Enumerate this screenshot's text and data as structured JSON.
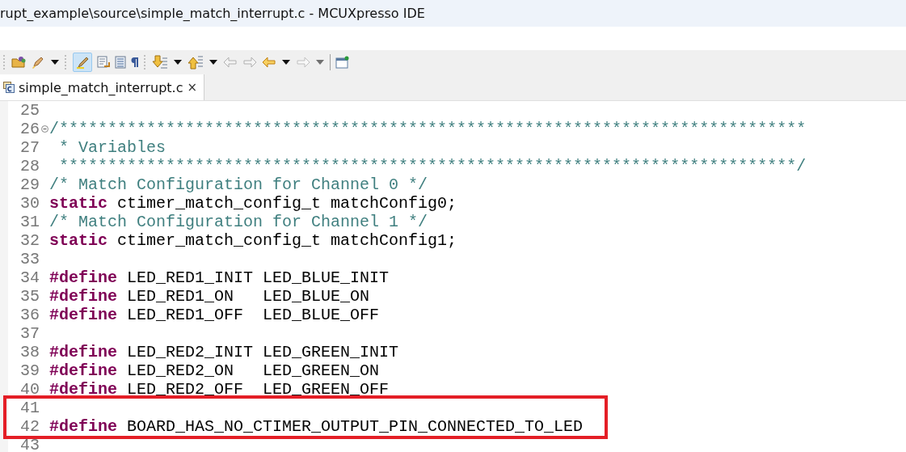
{
  "window": {
    "title": "rupt_example\\source\\simple_match_interrupt.c - MCUXpresso IDE"
  },
  "toolbar": {
    "toggle_on": true
  },
  "tabs": [
    {
      "label": "simple_match_interrupt.c",
      "close": "×",
      "selected": true
    }
  ],
  "editor": {
    "lines": [
      {
        "number": "25",
        "folded_marker": false,
        "highlighted": false
      },
      {
        "number": "26",
        "folded_marker": true,
        "highlighted": false,
        "tokens": [
          {
            "kind": "comment",
            "text": "/*****************************************************************************"
          }
        ]
      },
      {
        "number": "27",
        "folded_marker": false,
        "highlighted": false,
        "tokens": [
          {
            "kind": "comment",
            "text": " * Variables"
          }
        ]
      },
      {
        "number": "28",
        "folded_marker": false,
        "highlighted": false,
        "tokens": [
          {
            "kind": "comment",
            "text": " ****************************************************************************/"
          }
        ]
      },
      {
        "number": "29",
        "folded_marker": false,
        "highlighted": false,
        "tokens": [
          {
            "kind": "comment",
            "text": "/* Match Configuration for Channel 0 */"
          }
        ]
      },
      {
        "number": "30",
        "folded_marker": false,
        "highlighted": false,
        "tokens": [
          {
            "kind": "keyword",
            "text": "static"
          },
          {
            "kind": "plain",
            "text": " ctimer_match_config_t matchConfig0;"
          }
        ]
      },
      {
        "number": "31",
        "folded_marker": false,
        "highlighted": false,
        "tokens": [
          {
            "kind": "comment",
            "text": "/* Match Configuration for Channel 1 */"
          }
        ]
      },
      {
        "number": "32",
        "folded_marker": false,
        "highlighted": false,
        "tokens": [
          {
            "kind": "keyword",
            "text": "static"
          },
          {
            "kind": "plain",
            "text": " ctimer_match_config_t matchConfig1;"
          }
        ]
      },
      {
        "number": "33",
        "folded_marker": false,
        "highlighted": false
      },
      {
        "number": "34",
        "folded_marker": false,
        "highlighted": false,
        "tokens": [
          {
            "kind": "keyword",
            "text": "#define"
          },
          {
            "kind": "plain",
            "text": " LED_RED1_INIT LED_BLUE_INIT"
          }
        ]
      },
      {
        "number": "35",
        "folded_marker": false,
        "highlighted": false,
        "tokens": [
          {
            "kind": "keyword",
            "text": "#define"
          },
          {
            "kind": "plain",
            "text": " LED_RED1_ON   LED_BLUE_ON"
          }
        ]
      },
      {
        "number": "36",
        "folded_marker": false,
        "highlighted": false,
        "tokens": [
          {
            "kind": "keyword",
            "text": "#define"
          },
          {
            "kind": "plain",
            "text": " LED_RED1_OFF  LED_BLUE_OFF"
          }
        ]
      },
      {
        "number": "37",
        "folded_marker": false,
        "highlighted": false
      },
      {
        "number": "38",
        "folded_marker": false,
        "highlighted": false,
        "tokens": [
          {
            "kind": "keyword",
            "text": "#define"
          },
          {
            "kind": "plain",
            "text": " LED_RED2_INIT LED_GREEN_INIT"
          }
        ]
      },
      {
        "number": "39",
        "folded_marker": false,
        "highlighted": false,
        "tokens": [
          {
            "kind": "keyword",
            "text": "#define"
          },
          {
            "kind": "plain",
            "text": " LED_RED2_ON   LED_GREEN_ON"
          }
        ]
      },
      {
        "number": "40",
        "folded_marker": false,
        "highlighted": false,
        "tokens": [
          {
            "kind": "keyword",
            "text": "#define"
          },
          {
            "kind": "plain",
            "text": " LED_RED2_OFF  LED_GREEN_OFF"
          }
        ]
      },
      {
        "number": "41",
        "folded_marker": false,
        "highlighted": true
      },
      {
        "number": "42",
        "folded_marker": false,
        "highlighted": true,
        "tokens": [
          {
            "kind": "keyword",
            "text": "#define"
          },
          {
            "kind": "plain",
            "text": " BOARD_HAS_NO_CTIMER_OUTPUT_PIN_CONNECTED_TO_LED"
          }
        ]
      },
      {
        "number": "43",
        "folded_marker": false,
        "highlighted": false
      }
    ]
  }
}
